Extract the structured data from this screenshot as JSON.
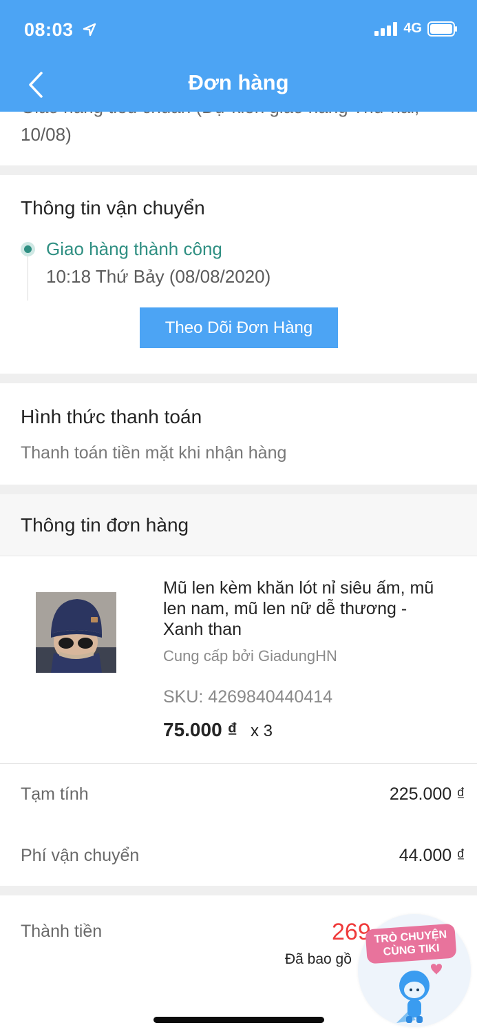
{
  "status": {
    "time": "08:03",
    "network": "4G"
  },
  "header": {
    "title": "Đơn hàng"
  },
  "delivery_method": {
    "text_line1": "Giao hàng tiêu chuẩn (Dự kiến giao hàng Thứ hai,",
    "text_line2": "10/08)"
  },
  "shipping": {
    "title": "Thông tin vận chuyển",
    "status": "Giao hàng thành công",
    "time": "10:18 Thứ Bảy (08/08/2020)",
    "track_button": "Theo Dõi Đơn Hàng"
  },
  "payment": {
    "title": "Hình thức thanh toán",
    "method": "Thanh toán tiền mặt khi nhận hàng"
  },
  "order": {
    "title": "Thông tin đơn hàng",
    "item": {
      "name_line1": "Mũ len kèm khăn lót nỉ siêu ấm, mũ",
      "name_line2": "len nam, mũ len nữ dễ thương -",
      "name_line3": "Xanh than",
      "seller": "Cung cấp bởi GiadungHN",
      "sku": "SKU: 4269840440414",
      "price": "75.000 ₫",
      "qty": "x 3"
    }
  },
  "summary": {
    "subtotal_label": "Tạm tính",
    "subtotal_value": "225.000 ₫",
    "shipping_label": "Phí vận chuyển",
    "shipping_value": "44.000 ₫",
    "total_label": "Thành tiền",
    "total_value_partial": "269",
    "vat_note_partial": "Đã bao gồ"
  },
  "chat_bubble": {
    "line1": "TRÒ CHUYỆN",
    "line2": "CÙNG TIKI"
  },
  "colors": {
    "header": "#4ca4f4",
    "success": "#2f8f82",
    "total_red": "#ef3b3b",
    "badge_pink": "#e8739c"
  }
}
